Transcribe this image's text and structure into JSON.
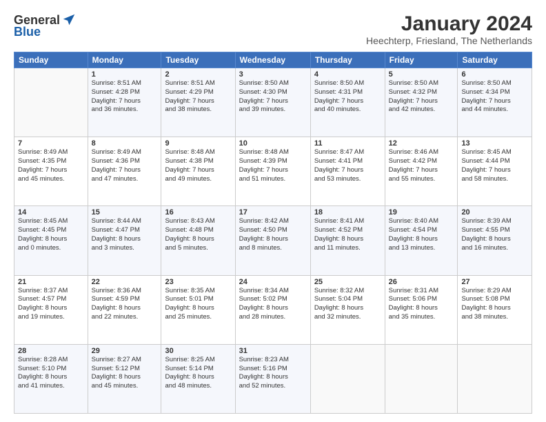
{
  "logo": {
    "general": "General",
    "blue": "Blue"
  },
  "title": "January 2024",
  "location": "Heechterp, Friesland, The Netherlands",
  "days_header": [
    "Sunday",
    "Monday",
    "Tuesday",
    "Wednesday",
    "Thursday",
    "Friday",
    "Saturday"
  ],
  "weeks": [
    [
      {
        "day": "",
        "sunrise": "",
        "sunset": "",
        "daylight": ""
      },
      {
        "day": "1",
        "sunrise": "Sunrise: 8:51 AM",
        "sunset": "Sunset: 4:28 PM",
        "daylight": "Daylight: 7 hours and 36 minutes."
      },
      {
        "day": "2",
        "sunrise": "Sunrise: 8:51 AM",
        "sunset": "Sunset: 4:29 PM",
        "daylight": "Daylight: 7 hours and 38 minutes."
      },
      {
        "day": "3",
        "sunrise": "Sunrise: 8:50 AM",
        "sunset": "Sunset: 4:30 PM",
        "daylight": "Daylight: 7 hours and 39 minutes."
      },
      {
        "day": "4",
        "sunrise": "Sunrise: 8:50 AM",
        "sunset": "Sunset: 4:31 PM",
        "daylight": "Daylight: 7 hours and 40 minutes."
      },
      {
        "day": "5",
        "sunrise": "Sunrise: 8:50 AM",
        "sunset": "Sunset: 4:32 PM",
        "daylight": "Daylight: 7 hours and 42 minutes."
      },
      {
        "day": "6",
        "sunrise": "Sunrise: 8:50 AM",
        "sunset": "Sunset: 4:34 PM",
        "daylight": "Daylight: 7 hours and 44 minutes."
      }
    ],
    [
      {
        "day": "7",
        "sunrise": "Sunrise: 8:49 AM",
        "sunset": "Sunset: 4:35 PM",
        "daylight": "Daylight: 7 hours and 45 minutes."
      },
      {
        "day": "8",
        "sunrise": "Sunrise: 8:49 AM",
        "sunset": "Sunset: 4:36 PM",
        "daylight": "Daylight: 7 hours and 47 minutes."
      },
      {
        "day": "9",
        "sunrise": "Sunrise: 8:48 AM",
        "sunset": "Sunset: 4:38 PM",
        "daylight": "Daylight: 7 hours and 49 minutes."
      },
      {
        "day": "10",
        "sunrise": "Sunrise: 8:48 AM",
        "sunset": "Sunset: 4:39 PM",
        "daylight": "Daylight: 7 hours and 51 minutes."
      },
      {
        "day": "11",
        "sunrise": "Sunrise: 8:47 AM",
        "sunset": "Sunset: 4:41 PM",
        "daylight": "Daylight: 7 hours and 53 minutes."
      },
      {
        "day": "12",
        "sunrise": "Sunrise: 8:46 AM",
        "sunset": "Sunset: 4:42 PM",
        "daylight": "Daylight: 7 hours and 55 minutes."
      },
      {
        "day": "13",
        "sunrise": "Sunrise: 8:45 AM",
        "sunset": "Sunset: 4:44 PM",
        "daylight": "Daylight: 7 hours and 58 minutes."
      }
    ],
    [
      {
        "day": "14",
        "sunrise": "Sunrise: 8:45 AM",
        "sunset": "Sunset: 4:45 PM",
        "daylight": "Daylight: 8 hours and 0 minutes."
      },
      {
        "day": "15",
        "sunrise": "Sunrise: 8:44 AM",
        "sunset": "Sunset: 4:47 PM",
        "daylight": "Daylight: 8 hours and 3 minutes."
      },
      {
        "day": "16",
        "sunrise": "Sunrise: 8:43 AM",
        "sunset": "Sunset: 4:48 PM",
        "daylight": "Daylight: 8 hours and 5 minutes."
      },
      {
        "day": "17",
        "sunrise": "Sunrise: 8:42 AM",
        "sunset": "Sunset: 4:50 PM",
        "daylight": "Daylight: 8 hours and 8 minutes."
      },
      {
        "day": "18",
        "sunrise": "Sunrise: 8:41 AM",
        "sunset": "Sunset: 4:52 PM",
        "daylight": "Daylight: 8 hours and 11 minutes."
      },
      {
        "day": "19",
        "sunrise": "Sunrise: 8:40 AM",
        "sunset": "Sunset: 4:54 PM",
        "daylight": "Daylight: 8 hours and 13 minutes."
      },
      {
        "day": "20",
        "sunrise": "Sunrise: 8:39 AM",
        "sunset": "Sunset: 4:55 PM",
        "daylight": "Daylight: 8 hours and 16 minutes."
      }
    ],
    [
      {
        "day": "21",
        "sunrise": "Sunrise: 8:37 AM",
        "sunset": "Sunset: 4:57 PM",
        "daylight": "Daylight: 8 hours and 19 minutes."
      },
      {
        "day": "22",
        "sunrise": "Sunrise: 8:36 AM",
        "sunset": "Sunset: 4:59 PM",
        "daylight": "Daylight: 8 hours and 22 minutes."
      },
      {
        "day": "23",
        "sunrise": "Sunrise: 8:35 AM",
        "sunset": "Sunset: 5:01 PM",
        "daylight": "Daylight: 8 hours and 25 minutes."
      },
      {
        "day": "24",
        "sunrise": "Sunrise: 8:34 AM",
        "sunset": "Sunset: 5:02 PM",
        "daylight": "Daylight: 8 hours and 28 minutes."
      },
      {
        "day": "25",
        "sunrise": "Sunrise: 8:32 AM",
        "sunset": "Sunset: 5:04 PM",
        "daylight": "Daylight: 8 hours and 32 minutes."
      },
      {
        "day": "26",
        "sunrise": "Sunrise: 8:31 AM",
        "sunset": "Sunset: 5:06 PM",
        "daylight": "Daylight: 8 hours and 35 minutes."
      },
      {
        "day": "27",
        "sunrise": "Sunrise: 8:29 AM",
        "sunset": "Sunset: 5:08 PM",
        "daylight": "Daylight: 8 hours and 38 minutes."
      }
    ],
    [
      {
        "day": "28",
        "sunrise": "Sunrise: 8:28 AM",
        "sunset": "Sunset: 5:10 PM",
        "daylight": "Daylight: 8 hours and 41 minutes."
      },
      {
        "day": "29",
        "sunrise": "Sunrise: 8:27 AM",
        "sunset": "Sunset: 5:12 PM",
        "daylight": "Daylight: 8 hours and 45 minutes."
      },
      {
        "day": "30",
        "sunrise": "Sunrise: 8:25 AM",
        "sunset": "Sunset: 5:14 PM",
        "daylight": "Daylight: 8 hours and 48 minutes."
      },
      {
        "day": "31",
        "sunrise": "Sunrise: 8:23 AM",
        "sunset": "Sunset: 5:16 PM",
        "daylight": "Daylight: 8 hours and 52 minutes."
      },
      {
        "day": "",
        "sunrise": "",
        "sunset": "",
        "daylight": ""
      },
      {
        "day": "",
        "sunrise": "",
        "sunset": "",
        "daylight": ""
      },
      {
        "day": "",
        "sunrise": "",
        "sunset": "",
        "daylight": ""
      }
    ]
  ]
}
